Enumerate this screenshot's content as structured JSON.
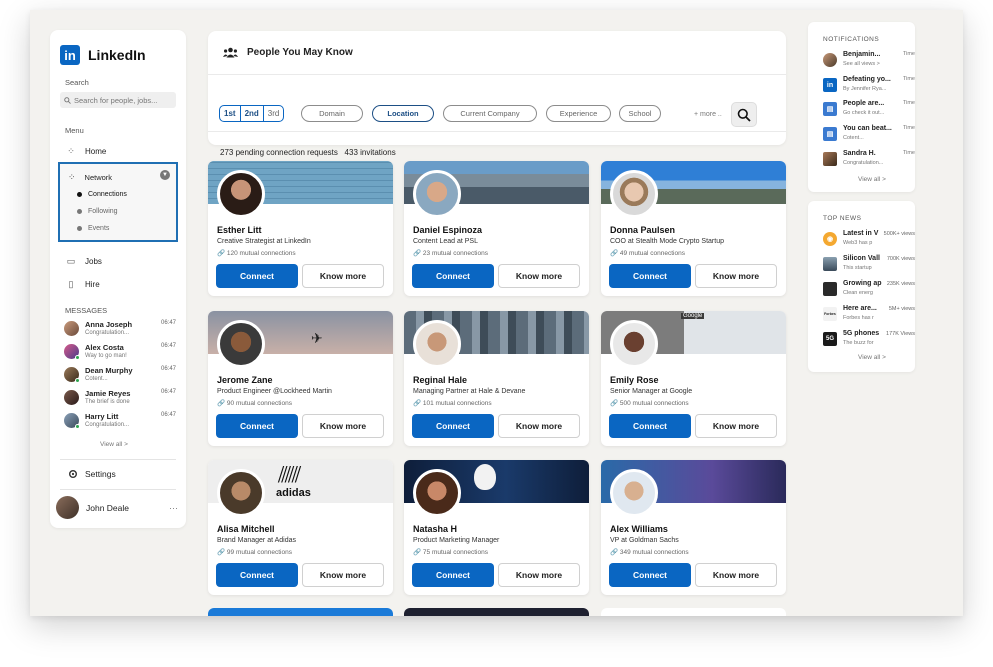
{
  "app": {
    "name": "LinkedIn",
    "logo_text": "in"
  },
  "sidebar": {
    "search_label": "Search",
    "search_placeholder": "Search for people, jobs...",
    "menu_label": "Menu",
    "home": "Home",
    "network": "Network",
    "network_sub": [
      "Connections",
      "Following",
      "Events"
    ],
    "jobs": "Jobs",
    "hire": "Hire",
    "messages_label": "MESSAGES",
    "messages": [
      {
        "name": "Anna Joseph",
        "preview": "Congratulation...",
        "time": "06:47"
      },
      {
        "name": "Alex Costa",
        "preview": "Way to go man!",
        "time": "06:47"
      },
      {
        "name": "Dean Murphy",
        "preview": "Cotent...",
        "time": "06:47"
      },
      {
        "name": "Jamie Reyes",
        "preview": "The brief is done",
        "time": "06:47"
      },
      {
        "name": "Harry Litt",
        "preview": "Congratulation...",
        "time": "06:47"
      }
    ],
    "view_all": "View all >",
    "settings": "Settings",
    "user_name": "John Deale",
    "user_more": "···"
  },
  "main": {
    "title": "People You May Know",
    "degrees": [
      "1st",
      "2nd",
      "3rd"
    ],
    "filters": [
      "Domain",
      "Location",
      "Current Company",
      "Experience",
      "School"
    ],
    "active_filter": "Location",
    "more": "+ more ..",
    "pending_text": "273 pending connection requests",
    "invitations_text": "433 invitations",
    "connect_label": "Connect",
    "know_more_label": "Know more",
    "cards": [
      {
        "name": "Esther Litt",
        "title": "Creative Strategist at LinkedIn",
        "mutual": "120 mutual connections"
      },
      {
        "name": "Daniel Espinoza",
        "title": "Content Lead at PSL",
        "mutual": "23 mutual connections"
      },
      {
        "name": "Donna Paulsen",
        "title": "COO at Stealth Mode Crypto Startup",
        "mutual": "49 mutual connections"
      },
      {
        "name": "Jerome Zane",
        "title": "Product Engineer @Lockheed Martin",
        "mutual": "90 mutual connections"
      },
      {
        "name": "Reginal Hale",
        "title": "Managing Partner at Hale & Devane",
        "mutual": "101 mutual connections"
      },
      {
        "name": "Emily Rose",
        "title": "Senior Manager at Google",
        "mutual": "500 mutual connections"
      },
      {
        "name": "Alisa Mitchell",
        "title": "Brand Manager at Adidas",
        "mutual": "99 mutual connections"
      },
      {
        "name": "Natasha H",
        "title": "Product Marketing Manager",
        "mutual": "75 mutual connections"
      },
      {
        "name": "Alex Williams",
        "title": "VP at Goldman Sachs",
        "mutual": "349 mutual connections"
      }
    ],
    "banner_texts": {
      "google": "Google",
      "adidas": "adidas"
    }
  },
  "notifications": {
    "title": "NOTIFICATIONS",
    "items": [
      {
        "title": "Benjamin...",
        "sub": "See all views >",
        "time": "Time"
      },
      {
        "title": "Defeating yo...",
        "sub": "By Jennifer Rya...",
        "time": "Time"
      },
      {
        "title": "People are...",
        "sub": "Go check it out...",
        "time": "Time"
      },
      {
        "title": "You can beat...",
        "sub": "Cotent...",
        "time": "Time"
      },
      {
        "title": "Sandra H.",
        "sub": "Congratulation...",
        "time": "Time"
      }
    ],
    "view_all": "View all >"
  },
  "news": {
    "title": "TOP NEWS",
    "items": [
      {
        "title": "Latest in V",
        "sub": "Web3 has p",
        "views": "500K+ views"
      },
      {
        "title": "Silicon Vall",
        "sub": "This startup",
        "views": "700K views"
      },
      {
        "title": "Growing ap",
        "sub": "Clean energ",
        "views": "235K views"
      },
      {
        "title": "Here are...",
        "sub": "Forbes has r",
        "views": "5M+ views"
      },
      {
        "title": "5G phones",
        "sub": "The buzz for",
        "views": "177K Views"
      }
    ],
    "view_all": "View all >",
    "icon_texts": [
      "Forbes",
      "5G"
    ]
  },
  "colors": {
    "brand": "#0a66c2",
    "highlight_border": "#1f6fb3",
    "online": "#2ea44f"
  }
}
